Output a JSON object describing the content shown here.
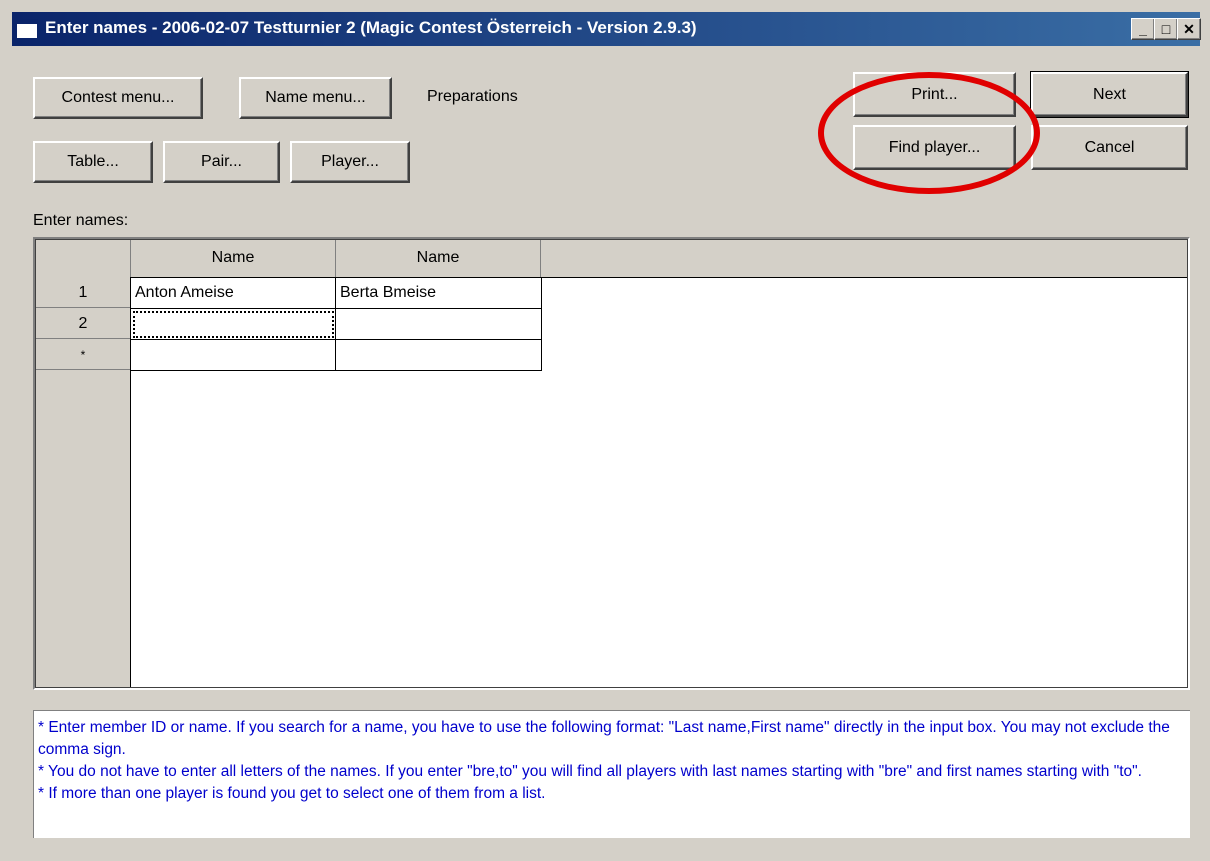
{
  "window": {
    "title": "Enter names - 2006-02-07  Testturnier 2  (Magic Contest Österreich - Version 2.9.3)",
    "controls": {
      "minimize": "_",
      "maximize": "□",
      "close": "✕"
    }
  },
  "toolbar": {
    "contest_menu": "Contest menu...",
    "name_menu": "Name menu...",
    "preparations_label": "Preparations",
    "table": "Table...",
    "pair": "Pair...",
    "player": "Player...",
    "print": "Print...",
    "next": "Next",
    "find_player": "Find player...",
    "cancel": "Cancel"
  },
  "grid": {
    "label": "Enter names:",
    "columns": [
      "Name",
      "Name"
    ],
    "rows": [
      {
        "num": "1",
        "cells": [
          "Anton Ameise",
          "Berta Bmeise"
        ]
      },
      {
        "num": "2",
        "cells": [
          "",
          ""
        ]
      },
      {
        "num": "*",
        "cells": [
          "",
          ""
        ]
      }
    ]
  },
  "help": {
    "line1": "* Enter member ID or name. If you search for a name, you have to use the following format: \"Last name,First name\" directly in the input box. You may not exclude the comma sign.",
    "line2": "* You do not have to enter all letters of the names. If you enter \"bre,to\" you will find all players with last names starting with \"bre\" and first names starting with \"to\".",
    "line3": "* If more than one player is found you get to select one of them from a list."
  },
  "colors": {
    "annotation": "#e00000",
    "help_text": "#0000cc",
    "titlebar": "#0a246a"
  }
}
